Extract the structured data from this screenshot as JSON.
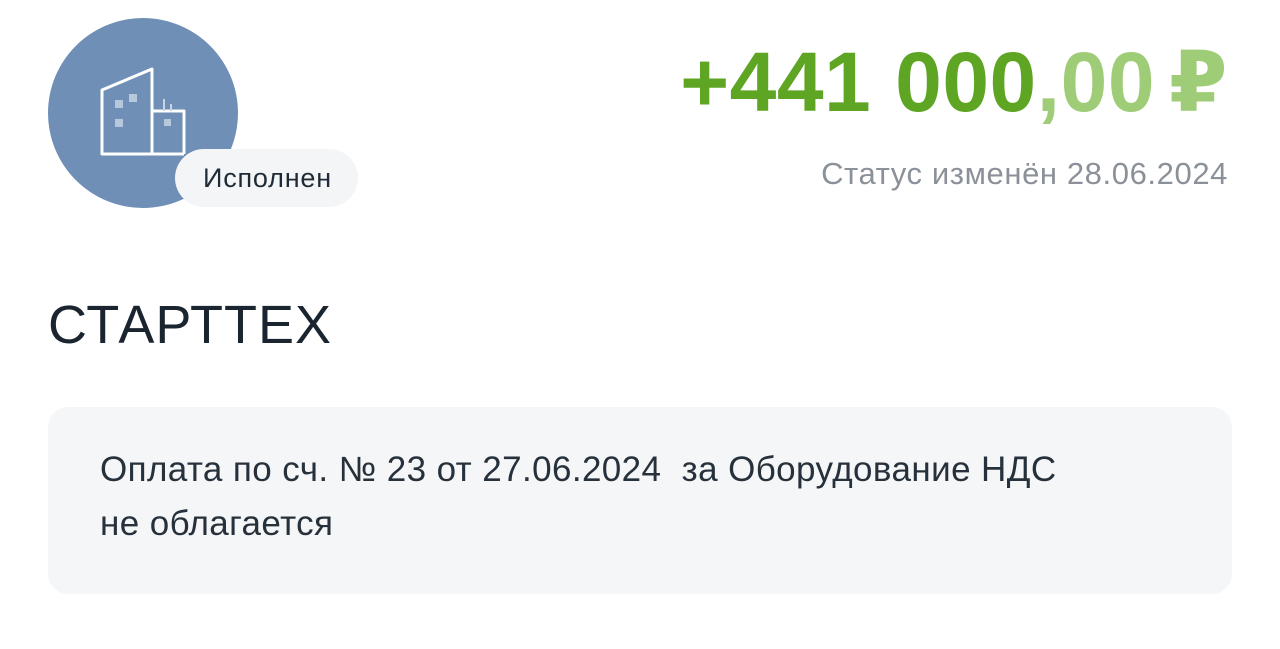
{
  "header": {
    "avatar_icon": "building-icon",
    "status_label": "Исполнен",
    "amount_integer": "+441 000",
    "amount_fraction": ",00",
    "currency_symbol": "₽",
    "status_changed_text": "Статус изменён 28.06.2024"
  },
  "counterparty": {
    "name": "СТАРТТЕХ"
  },
  "payment": {
    "purpose": "Оплата по сч. № 23 от 27.06.2024  за Оборудование НДС\nне облагается"
  },
  "colors": {
    "amount_green": "#5fa524",
    "amount_green_light": "#9fcc76",
    "avatar_blue": "#6f8fb6",
    "muted_text": "#8b9198"
  }
}
